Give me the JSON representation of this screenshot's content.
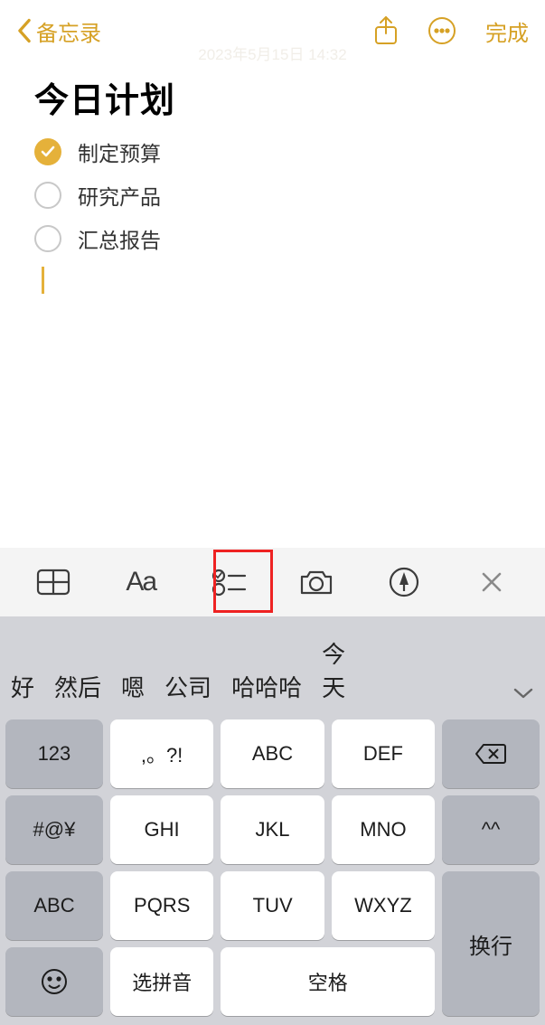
{
  "header": {
    "back_label": "备忘录",
    "done": "完成",
    "watermark": "2023年5月15日 14:32"
  },
  "note": {
    "title": "今日计划",
    "items": [
      {
        "text": "制定预算",
        "checked": true
      },
      {
        "text": "研究产品",
        "checked": false
      },
      {
        "text": "汇总报告",
        "checked": false
      }
    ]
  },
  "toolbar": {
    "aa": "Aa"
  },
  "suggestions": [
    "好",
    "然后",
    "嗯",
    "公司",
    "哈哈哈",
    "今天"
  ],
  "keyboard": {
    "r1": [
      "123",
      ",。?!",
      "ABC",
      "DEF"
    ],
    "r2": [
      "#@¥",
      "GHI",
      "JKL",
      "MNO",
      "^^"
    ],
    "r3": [
      "ABC",
      "PQRS",
      "TUV",
      "WXYZ"
    ],
    "r4": {
      "pinyin": "选拼音",
      "space": "空格",
      "enter": "换行"
    }
  }
}
